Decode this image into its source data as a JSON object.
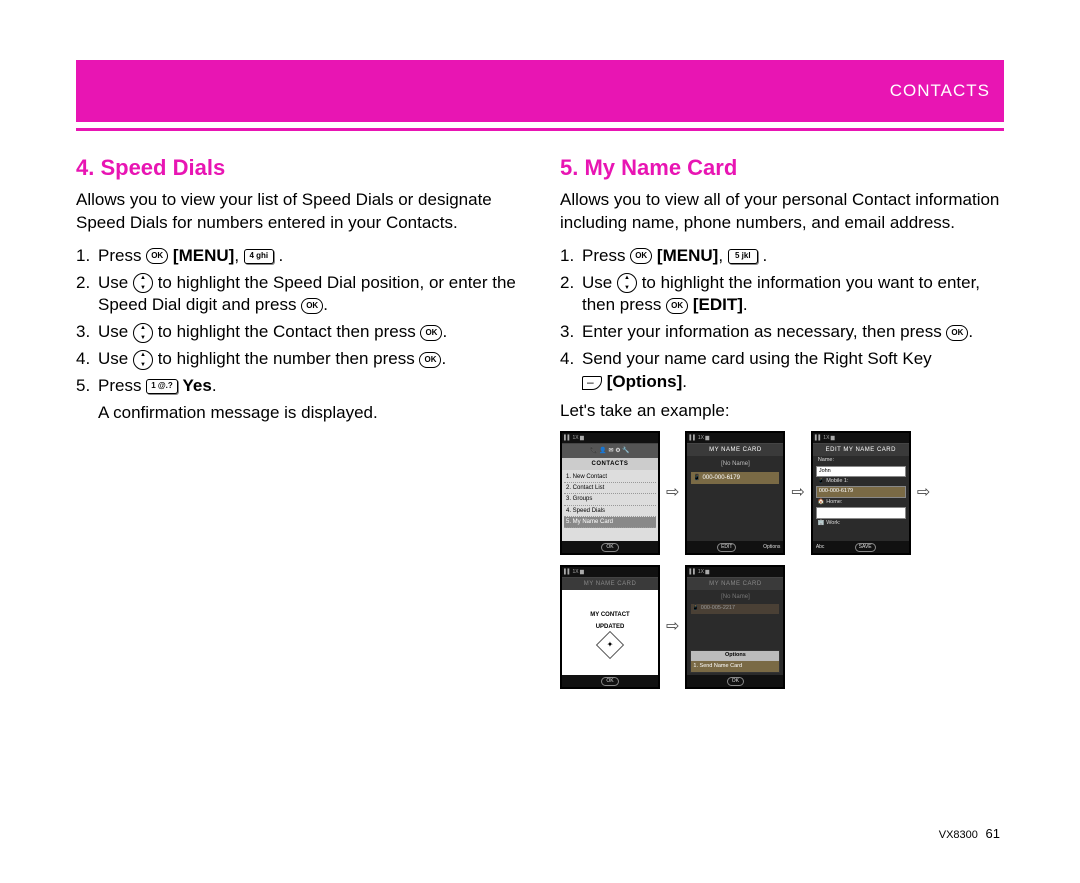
{
  "header": {
    "section": "CONTACTS"
  },
  "left": {
    "title": "4. Speed Dials",
    "intro": "Allows you to view your list of Speed Dials or designate Speed Dials for numbers entered in your Contacts.",
    "step1_a": "Press ",
    "step1_menu": "MENU",
    "step1_b": ", ",
    "key4": "4 ghi",
    "step1_c": " .",
    "step2_a": "Use ",
    "step2_b": " to highlight the Speed Dial position, or enter the Speed Dial digit and press ",
    "step2_c": ".",
    "step3_a": "Use ",
    "step3_b": " to highlight the Contact then press ",
    "step3_c": ".",
    "step4_a": "Use ",
    "step4_b": " to highlight the number then press ",
    "step4_c": ".",
    "step5_a": "Press ",
    "key1": "1 @.?",
    "step5_yes": " Yes",
    "step5_b": ".",
    "confirm": "A confirmation message is displayed."
  },
  "right": {
    "title": "5. My Name Card",
    "intro": "Allows you to view all of your personal Contact information including name, phone numbers, and email address.",
    "step1_a": "Press ",
    "step1_menu": "MENU",
    "step1_b": ", ",
    "key5": "5 jkl",
    "step1_c": " .",
    "step2_a": "Use ",
    "step2_b": " to highlight the information you want to enter, then press ",
    "step2_edit": "EDIT",
    "step2_c": ".",
    "step3": "Enter your information as necessary, then press ",
    "step3_c": ".",
    "step4": "Send your name card using the Right Soft Key ",
    "step4_opt": "Options",
    "step4_c": ".",
    "example": "Let's take an example:"
  },
  "shots": {
    "s1": {
      "title": "CONTACTS",
      "items": [
        "1. New Contact",
        "2. Contact List",
        "3. Groups",
        "4. Speed Dials",
        "5. My Name Card"
      ],
      "bottom_center": "OK"
    },
    "s2": {
      "title": "MY NAME CARD",
      "noname": "[No Name]",
      "number": "000-000-6179",
      "bottom_left": "",
      "bottom_center": "EDIT",
      "bottom_right": "Options"
    },
    "s3": {
      "title": "EDIT MY NAME CARD",
      "name_label": "Name:",
      "name_val": "John",
      "mob_label": "Mobile 1:",
      "mob_val": "000-000-6179",
      "home_label": "Home:",
      "work_label": "Work:",
      "bottom_left": "Abc",
      "bottom_center": "SAVE",
      "bottom_right": ""
    },
    "s4": {
      "title": "MY NAME CARD",
      "line1": "MY CONTACT",
      "line2": "UPDATED",
      "bottom_center": "OK"
    },
    "s5": {
      "title": "MY NAME CARD",
      "noname": "[No Name]",
      "number": "000-005-2217",
      "popup": "Options",
      "popup_item": "1. Send Name Card",
      "bottom_center": "OK"
    }
  },
  "footer": {
    "model": "VX8300",
    "page": "61"
  },
  "icons": {
    "ok": "OK"
  }
}
